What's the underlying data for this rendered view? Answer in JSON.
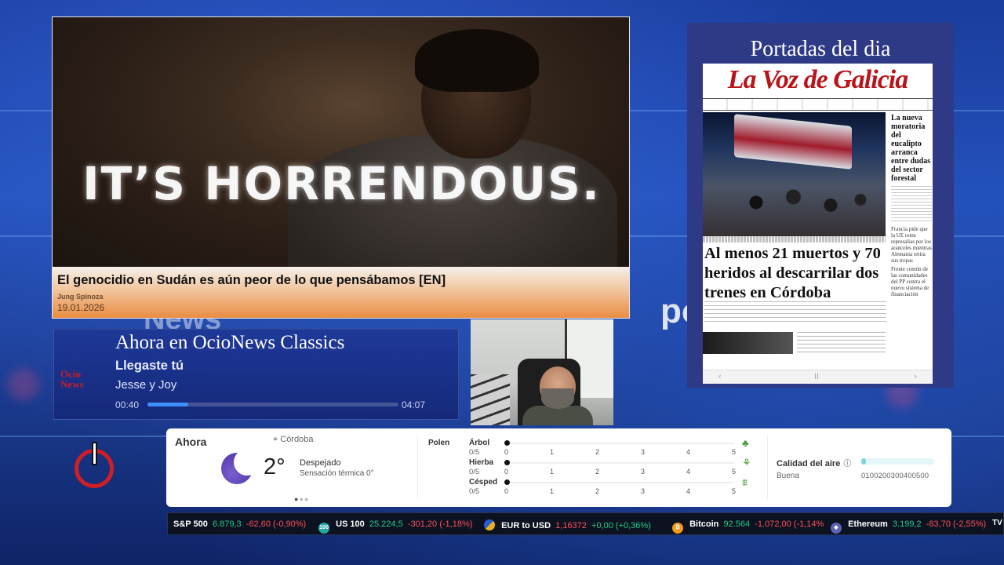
{
  "background": {
    "words": [
      "News",
      "po"
    ]
  },
  "video": {
    "overlay_text": "IT’S HORRENDOUS.",
    "title": "El genocidio en Sudán es aún peor de lo que pensábamos [EN]",
    "author": "Jung Spinoza",
    "date": "19.01.2026"
  },
  "portadas": {
    "title": "Portadas del dia",
    "masthead": "La Voz de Galicia",
    "headline": "Al menos 21 muertos y 70 heridos al descarrilar dos trenes en Córdoba",
    "side_headline_1": "La nueva moratoria del eucalipto arranca entre dudas del sector forestal",
    "side_headline_2": "Francia pide que la UE tome represalias por los aranceles mientras Alemania retira sus tropas",
    "side_headline_3": "Frente común de las comunidades del PP contra el nuevo sistema de financiación",
    "nav": {
      "prev": "‹",
      "pause": "II",
      "next": "›"
    }
  },
  "now_playing": {
    "logo_line1": "Ocio",
    "logo_line2": "News",
    "heading": "Ahora en OcioNews Classics",
    "song": "Llegaste tú",
    "artist": "Jesse y Joy",
    "time_elapsed": "00:40",
    "time_total": "04:07",
    "progress": 0.164
  },
  "weather": {
    "label": "Ahora",
    "location": "Córdoba",
    "temperature": "2°",
    "condition": "Despejado",
    "feels_like": "Sensación térmica 0°",
    "page_indicator": {
      "count": 3,
      "active": 0
    },
    "pollen": {
      "label": "Polen",
      "scale": [
        "0",
        "1",
        "2",
        "3",
        "4",
        "5"
      ],
      "rows": [
        {
          "name": "Árbol",
          "value": "0/5",
          "level": 0,
          "icon": "tree-icon"
        },
        {
          "name": "Hierba",
          "value": "0/5",
          "level": 0,
          "icon": "grass-icon"
        },
        {
          "name": "Césped",
          "value": "0/5",
          "level": 0,
          "icon": "lawn-icon"
        }
      ]
    },
    "air_quality": {
      "label": "Calidad del aire",
      "value": "Buena",
      "scale": "0100200300400500",
      "level": 0.06
    }
  },
  "ticker": [
    {
      "name": "S&P 500",
      "price": "6.879,3",
      "change": "-62,60 (-0,90%)"
    },
    {
      "icon_text": "100",
      "name": "US 100",
      "price": "25.224,5",
      "change": "-301,20 (-1,18%)"
    },
    {
      "name": "EUR to USD",
      "price": "1,16372",
      "change": "+0,00 (+0,36%)"
    },
    {
      "icon_text": "₿",
      "name": "Bitcoin",
      "price": "92.564",
      "change": "-1.072,00 (-1,14%"
    },
    {
      "icon_text": "◆",
      "name": "Ethereum",
      "price": "3.199,2",
      "change": "-83,70 (-2,55%)"
    },
    {
      "icon_text": "TV"
    }
  ],
  "colors": {
    "accent_red": "#d01e24",
    "ticker_up": "#1ecb8a",
    "ticker_down": "#ff4f5b",
    "panel_blue": "#2e3a86"
  }
}
